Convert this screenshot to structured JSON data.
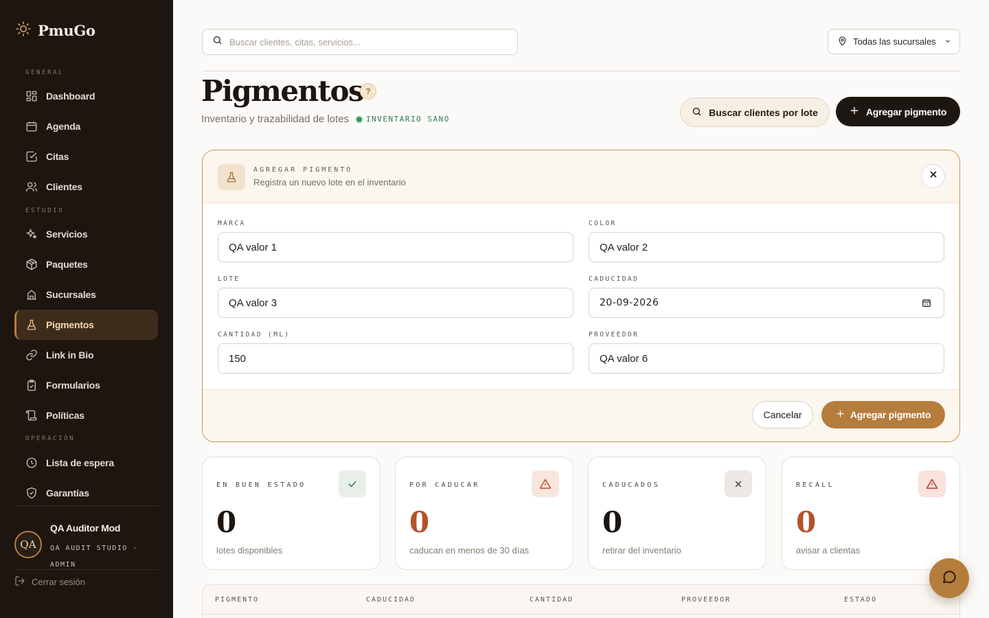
{
  "app": {
    "name": "PmuGo"
  },
  "sidebar": {
    "sections": {
      "general": "GENERAL",
      "studio": "ESTUDIO",
      "operation": "OPERACIÓN"
    },
    "items": [
      {
        "label": "Dashboard",
        "icon": "dashboard-icon"
      },
      {
        "label": "Agenda",
        "icon": "calendar-icon"
      },
      {
        "label": "Citas",
        "icon": "check-square-icon"
      },
      {
        "label": "Clientes",
        "icon": "users-icon"
      },
      {
        "label": "Servicios",
        "icon": "sparkles-icon"
      },
      {
        "label": "Paquetes",
        "icon": "package-icon"
      },
      {
        "label": "Sucursales",
        "icon": "building-icon"
      },
      {
        "label": "Pigmentos",
        "icon": "flask-icon",
        "active": true
      },
      {
        "label": "Link in Bio",
        "icon": "link-icon"
      },
      {
        "label": "Formularios",
        "icon": "clipboard-icon"
      },
      {
        "label": "Políticas",
        "icon": "scroll-icon"
      },
      {
        "label": "Lista de espera",
        "icon": "clock-icon"
      },
      {
        "label": "Garantías",
        "icon": "shield-check-icon"
      }
    ],
    "user": {
      "initials": "QA",
      "name": "QA Auditor Mod",
      "studio": "QA AUDIT STUDIO · ADMIN"
    },
    "logout": "Cerrar sesión"
  },
  "topbar": {
    "search_placeholder": "Buscar clientes, citas, servicios...",
    "branch": "Todas las sucursales"
  },
  "header": {
    "title": "Pigmentos",
    "help": "?",
    "subtitle": "Inventario y trazabilidad de lotes",
    "status": "INVENTARIO SANO",
    "search_lote_btn": "Buscar clientes por lote",
    "add_btn": "Agregar pigmento"
  },
  "form": {
    "kicker": "AGREGAR PIGMENTO",
    "description": "Registra un nuevo lote en el inventario",
    "fields": {
      "marca": {
        "label": "MARCA",
        "value": "QA valor 1"
      },
      "color": {
        "label": "COLOR",
        "value": "QA valor 2"
      },
      "lote": {
        "label": "LOTE",
        "value": "QA valor 3"
      },
      "caducidad": {
        "label": "CADUCIDAD",
        "value": "20-09-2026"
      },
      "cantidad": {
        "label": "CANTIDAD (ML)",
        "value": "150"
      },
      "proveedor": {
        "label": "PROVEEDOR",
        "value": "QA valor 6"
      }
    },
    "cancel": "Cancelar",
    "submit": "Agregar pigmento"
  },
  "stats": [
    {
      "kicker": "EN BUEN ESTADO",
      "value": "0",
      "caption": "lotes disponibles",
      "icon": "check-icon",
      "color": "#1c1510",
      "icon_bg": "#e6efe8",
      "icon_color": "#2f7a4e"
    },
    {
      "kicker": "POR CADUCAR",
      "value": "0",
      "caption": "caducan en menos de 30 días",
      "icon": "alert-triangle-icon",
      "color": "#b5532a",
      "icon_bg": "#f8e6dc",
      "icon_color": "#b5532a"
    },
    {
      "kicker": "CADUCADOS",
      "value": "0",
      "caption": "retirar del inventario",
      "icon": "x-icon",
      "color": "#1c1510",
      "icon_bg": "#ebe8e5",
      "icon_color": "#4a4038"
    },
    {
      "kicker": "RECALL",
      "value": "0",
      "caption": "avisar a clientas",
      "icon": "alert-triangle-icon",
      "color": "#b5532a",
      "icon_bg": "#f8e2dc",
      "icon_color": "#b53a2a"
    }
  ],
  "table": {
    "headers": [
      "PIGMENTO",
      "CADUCIDAD",
      "CANTIDAD",
      "PROVEEDOR",
      "ESTADO"
    ]
  },
  "colors": {
    "accent": "#b57d3c",
    "sidebar_bg": "#1c1510",
    "ok": "#2f7a4e",
    "warn": "#b5532a"
  }
}
